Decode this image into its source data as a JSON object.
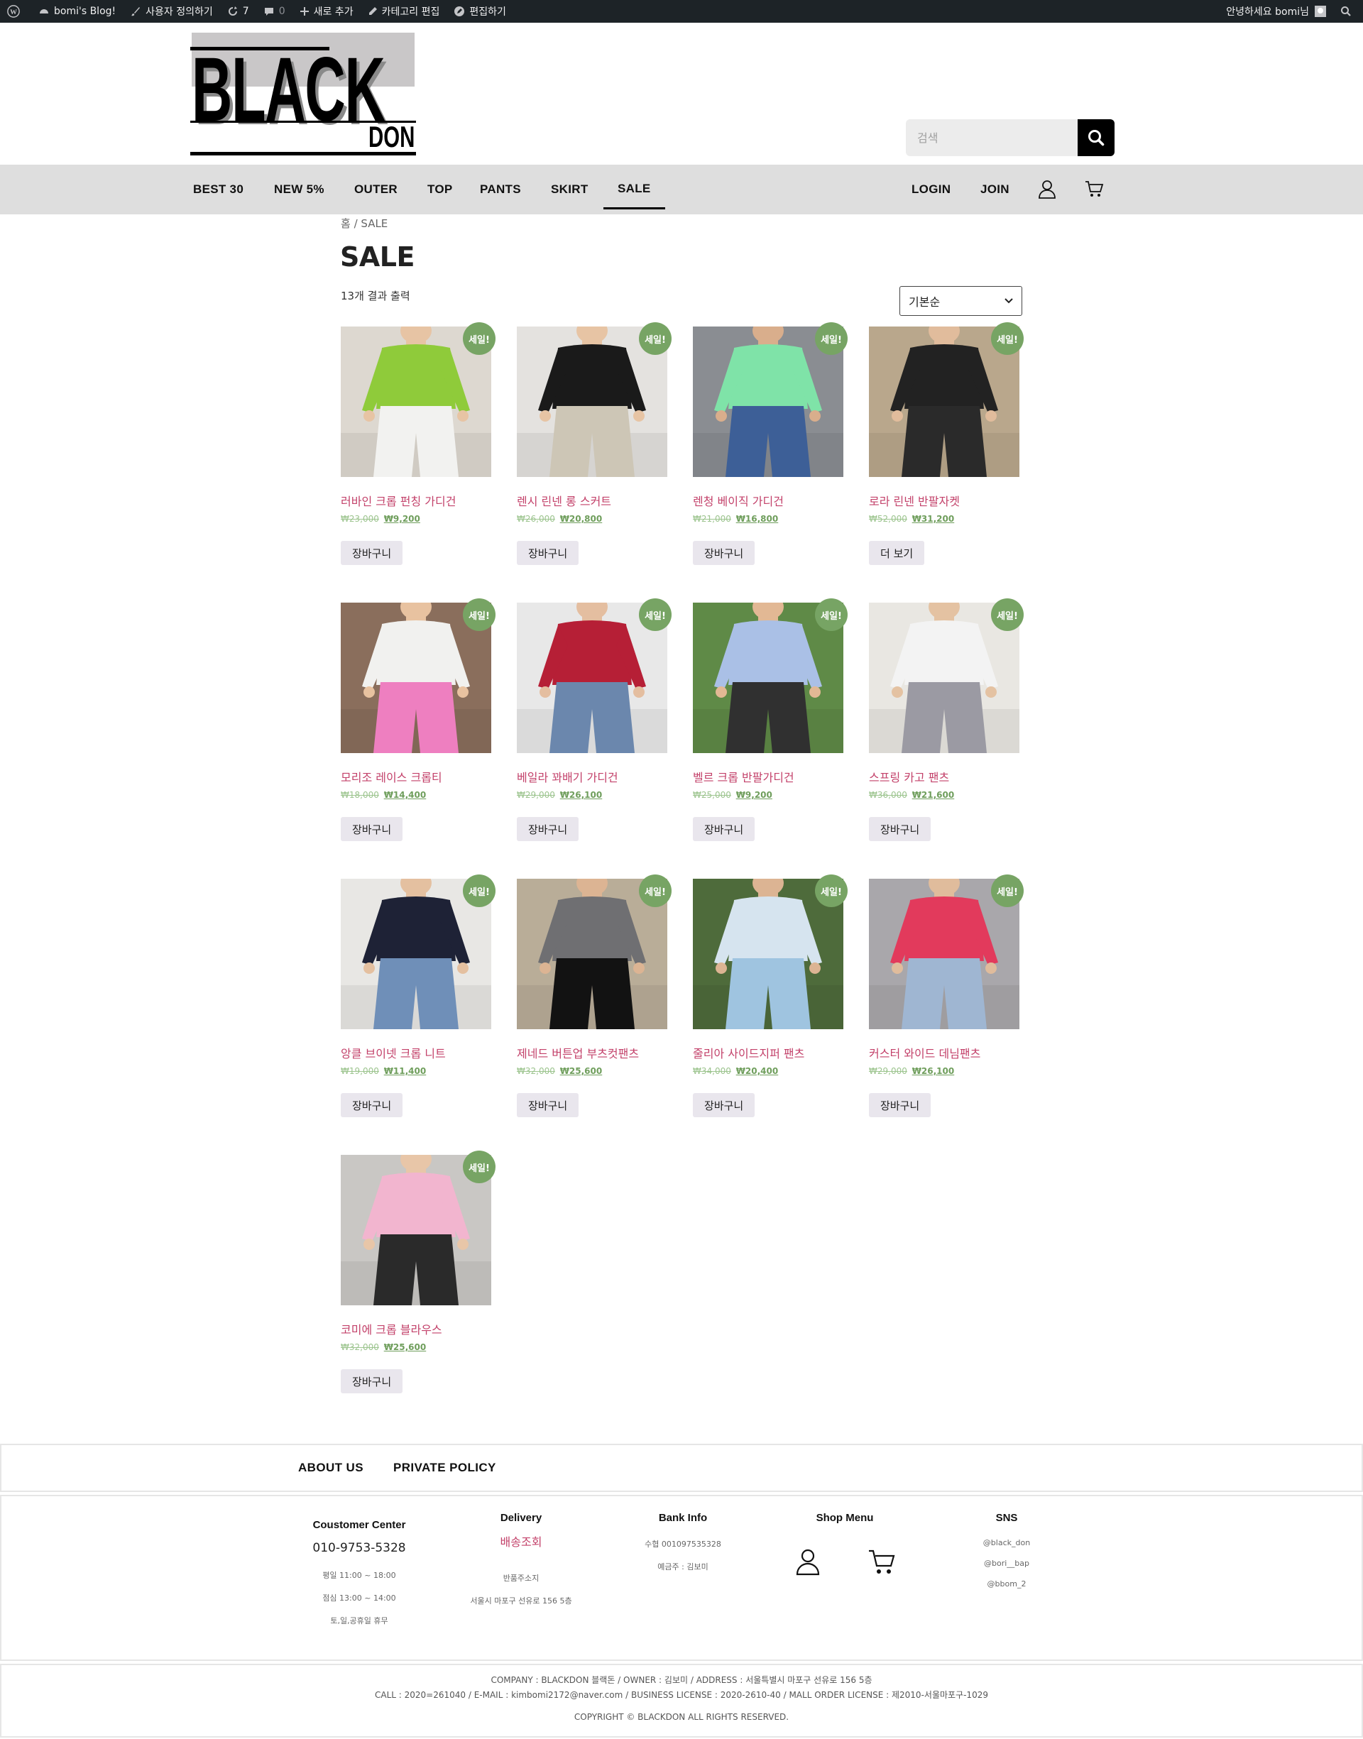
{
  "adminbar": {
    "site": "bomi's Blog!",
    "customize": "사용자 정의하기",
    "updates": "7",
    "comments": "0",
    "new": "새로 추가",
    "edit_category": "카테고리 편집",
    "edit": "편집하기",
    "greeting": "안녕하세요 bomi님"
  },
  "header": {
    "logo_word": "BLACK",
    "logo_sub": "DON",
    "search_placeholder": "검색"
  },
  "nav": {
    "items": [
      "BEST 30",
      "NEW 5%",
      "OUTER",
      "TOP",
      "PANTS",
      "SKIRT",
      "SALE"
    ],
    "active": "SALE",
    "login": "LOGIN",
    "join": "JOIN"
  },
  "page": {
    "breadcrumb": "홈 / SALE",
    "title": "SALE",
    "result_count": "13개 결과 출력",
    "orderby": "기본순"
  },
  "products": [
    {
      "name": "러바인 크롭 펀칭 가디건",
      "old": "₩23,000",
      "new": "₩9,200",
      "badge": "세일!",
      "button": "장바구니",
      "img": "green-cardigan"
    },
    {
      "name": "렌시 린넨 롱 스커트",
      "old": "₩26,000",
      "new": "₩20,800",
      "badge": "세일!",
      "button": "장바구니",
      "img": "linen-skirt"
    },
    {
      "name": "렌청 베이직 가디건",
      "old": "₩21,000",
      "new": "₩16,800",
      "badge": "세일!",
      "button": "장바구니",
      "img": "mint-cardigan"
    },
    {
      "name": "로라 린넨 반팔자켓",
      "old": "₩52,000",
      "new": "₩31,200",
      "badge": "세일!",
      "button": "더 보기",
      "img": "black-jacket"
    },
    {
      "name": "모리조 레이스 크롭티",
      "old": "₩18,000",
      "new": "₩14,400",
      "badge": "세일!",
      "button": "장바구니",
      "img": "lace-top"
    },
    {
      "name": "베일라 꽈배기 가디건",
      "old": "₩29,000",
      "new": "₩26,100",
      "badge": "세일!",
      "button": "장바구니",
      "img": "red-cardigan"
    },
    {
      "name": "벨르 크롭 반팔가디건",
      "old": "₩25,000",
      "new": "₩9,200",
      "badge": "세일!",
      "button": "장바구니",
      "img": "pastel-cardigan"
    },
    {
      "name": "스프링 카고 팬츠",
      "old": "₩36,000",
      "new": "₩21,600",
      "badge": "세일!",
      "button": "장바구니",
      "img": "grey-cargo"
    },
    {
      "name": "앙클 브이넷 크롭 니트",
      "old": "₩19,000",
      "new": "₩11,400",
      "badge": "세일!",
      "button": "장바구니",
      "img": "navy-knit"
    },
    {
      "name": "제네드 버튼업 부츠컷팬츠",
      "old": "₩32,000",
      "new": "₩25,600",
      "badge": "세일!",
      "button": "장바구니",
      "img": "bootcut"
    },
    {
      "name": "줄리아 사이드지퍼 팬츠",
      "old": "₩34,000",
      "new": "₩20,400",
      "badge": "세일!",
      "button": "장바구니",
      "img": "blue-jeans"
    },
    {
      "name": "커스터 와이드 데님팬츠",
      "old": "₩29,000",
      "new": "₩26,100",
      "badge": "세일!",
      "button": "장바구니",
      "img": "wide-denim"
    },
    {
      "name": "코미에 크롭 블라우스",
      "old": "₩32,000",
      "new": "₩25,600",
      "badge": "세일!",
      "button": "장바구니",
      "img": "pink-blouse"
    }
  ],
  "footer": {
    "about": "ABOUT US",
    "privacy": "PRIVATE POLICY",
    "customer_title": "Coustomer Center",
    "phone": "010-9753-5328",
    "hours1": "평일 11:00 ~ 18:00",
    "hours2": "점심 13:00 ~ 14:00",
    "hours3": "토,일,공휴일 휴무",
    "delivery_title": "Delivery",
    "delivery_link": "배송조회",
    "return_label": "반품주소지",
    "return_addr": "서울시 마포구 선유로 156 5층",
    "bank_title": "Bank Info",
    "bank_account": "수협  001097535328",
    "bank_holder": "예금주 : 김보미",
    "shop_title": "Shop Menu",
    "sns_title": "SNS",
    "sns": [
      "@black_don",
      "@bori__bap",
      "@bbom_2"
    ],
    "company_line": "COMPANY : BLACKDON 블랙돈 / OWNER : 김보미 / ADDRESS :  서울특별시 마포구 선유로 156 5층",
    "contact_line": "CALL : 2020=261040 / E-MAIL : kimbomi2172@naver.com / BUSINESS LICENSE : 2020-2610-40 / MALL ORDER LICENSE : 제2010-서울마포구-1029",
    "copyright": "COPYRIGHT © BLACKDON ALL RIGHTS RESERVED."
  },
  "colors": {
    "badge": "#77a464",
    "product_name": "#c3416a",
    "price_new": "#6f9e5c",
    "price_old": "#9cc48e",
    "nav_bg": "#dedede",
    "adminbar_bg": "#1d2327"
  }
}
